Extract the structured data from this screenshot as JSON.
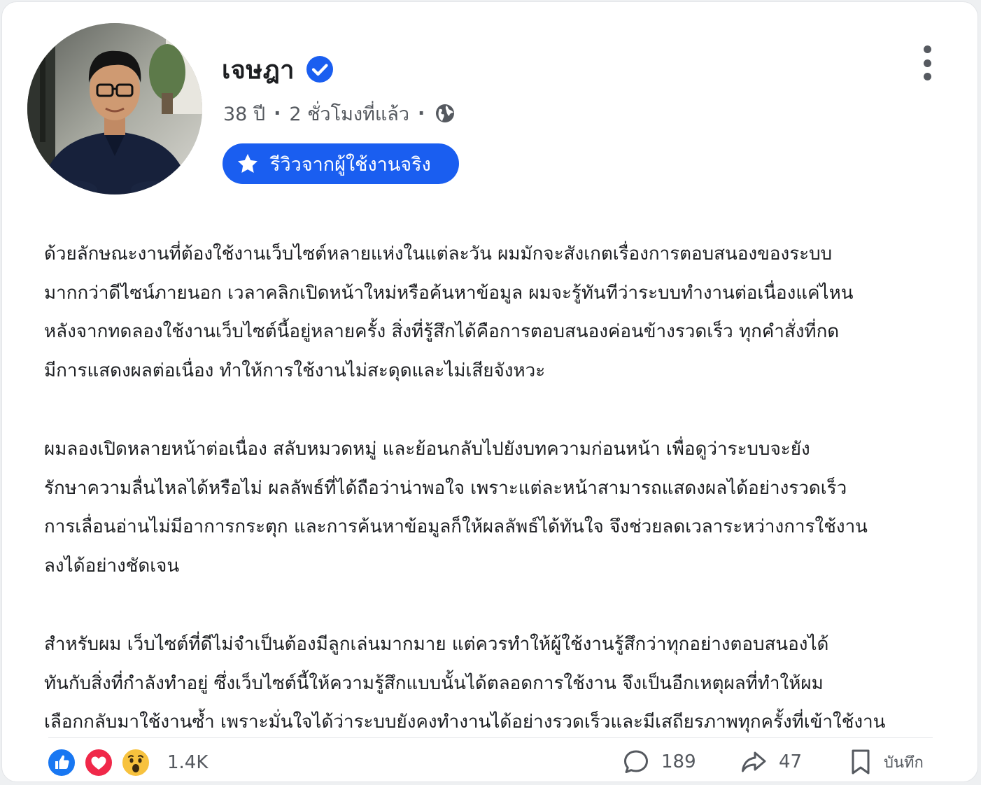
{
  "post": {
    "author": {
      "name": "เจษฎา",
      "verified": true,
      "age": "38 ปี",
      "time": "2 ชั่วโมงที่แล้ว",
      "visibility_icon": "globe-icon"
    },
    "badge": {
      "icon": "star-icon",
      "label": "รีวิวจากผู้ใช้งานจริง",
      "color": "#1a5ef0"
    },
    "menu_icon": "more-vertical-icon",
    "paragraphs": [
      [
        "ด้วยลักษณะงานที่ต้องใช้งานเว็บไซต์หลายแห่งในแต่ละวัน ผมมักจะสังเกตเรื่องการตอบสนองของระบบ",
        "มากกว่าดีไซน์ภายนอก เวลาคลิกเปิดหน้าใหม่หรือค้นหาข้อมูล ผมจะรู้ทันทีว่าระบบทำงานต่อเนื่องแค่ไหน",
        "หลังจากทดลองใช้งานเว็บไซต์นี้อยู่หลายครั้ง สิ่งที่รู้สึกได้คือการตอบสนองค่อนข้างรวดเร็ว ทุกคำสั่งที่กด",
        "มีการแสดงผลต่อเนื่อง ทำให้การใช้งานไม่สะดุดและไม่เสียจังหวะ"
      ],
      [
        "ผมลองเปิดหลายหน้าต่อเนื่อง สลับหมวดหมู่ และย้อนกลับไปยังบทความก่อนหน้า เพื่อดูว่าระบบจะยัง",
        "รักษาความลื่นไหลได้หรือไม่ ผลลัพธ์ที่ได้ถือว่าน่าพอใจ เพราะแต่ละหน้าสามารถแสดงผลได้อย่างรวดเร็ว",
        "การเลื่อนอ่านไม่มีอาการกระตุก และการค้นหาข้อมูลก็ให้ผลลัพธ์ได้ทันใจ จึงช่วยลดเวลาระหว่างการใช้งาน",
        "ลงได้อย่างชัดเจน"
      ],
      [
        "สำหรับผม เว็บไซต์ที่ดีไม่จำเป็นต้องมีลูกเล่นมากมาย แต่ควรทำให้ผู้ใช้งานรู้สึกว่าทุกอย่างตอบสนองได้",
        "ทันกับสิ่งที่กำลังทำอยู่ ซึ่งเว็บไซต์นี้ให้ความรู้สึกแบบนั้นได้ตลอดการใช้งาน จึงเป็นอีกเหตุผลที่ทำให้ผม",
        "เลือกกลับมาใช้งานซ้ำ เพราะมั่นใจได้ว่าระบบยังคงทำงานได้อย่างรวดเร็วและมีเสถียรภาพทุกครั้งที่เข้าใช้งาน"
      ]
    ]
  },
  "footer": {
    "reactions": [
      "like-icon",
      "love-icon",
      "wow-icon"
    ],
    "reaction_count": "1.4K",
    "comments": {
      "icon": "comment-icon",
      "count": "189"
    },
    "shares": {
      "icon": "share-icon",
      "count": "47"
    },
    "save": {
      "icon": "bookmark-icon",
      "label": "บันทึก"
    }
  },
  "colors": {
    "accent": "#1a5ef0",
    "like": "#1877f2",
    "love": "#f02849",
    "wow": "#f7c23e"
  }
}
